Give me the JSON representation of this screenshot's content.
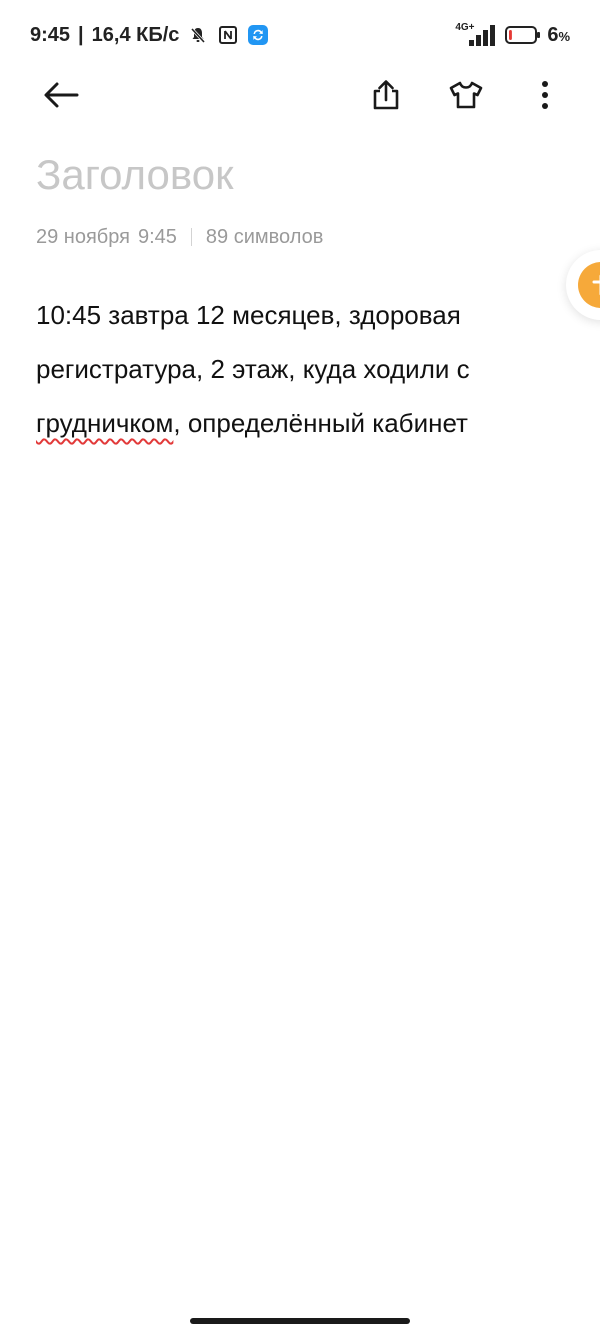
{
  "status_bar": {
    "time": "9:45",
    "separator": "|",
    "speed": "16,4 КБ/с",
    "network_label": "4G+",
    "battery_percent": "6",
    "battery_unit": "%",
    "battery_level": 0.06,
    "icons": [
      "bell-off-icon",
      "nfc-icon",
      "sync-icon",
      "signal-icon",
      "battery-icon"
    ]
  },
  "toolbar": {
    "icons": [
      "back-arrow-icon",
      "share-icon",
      "theme-shirt-icon",
      "more-vert-icon"
    ]
  },
  "note": {
    "title_placeholder": "Заголовок",
    "date": "29 ноября",
    "time": "9:45",
    "char_count": "89 символов",
    "body_part1": "10:45 завтра 12 месяцев, здоровая регистратура, 2 этаж, куда ходили с ",
    "body_misspelled": "грудничком",
    "body_part2": ", определённый кабинет"
  },
  "colors": {
    "accent": "#f6a93a",
    "placeholder": "#c7c7c7",
    "meta": "#9a9a9a",
    "spellcheck": "#e23a3a",
    "sync": "#2196f3"
  }
}
